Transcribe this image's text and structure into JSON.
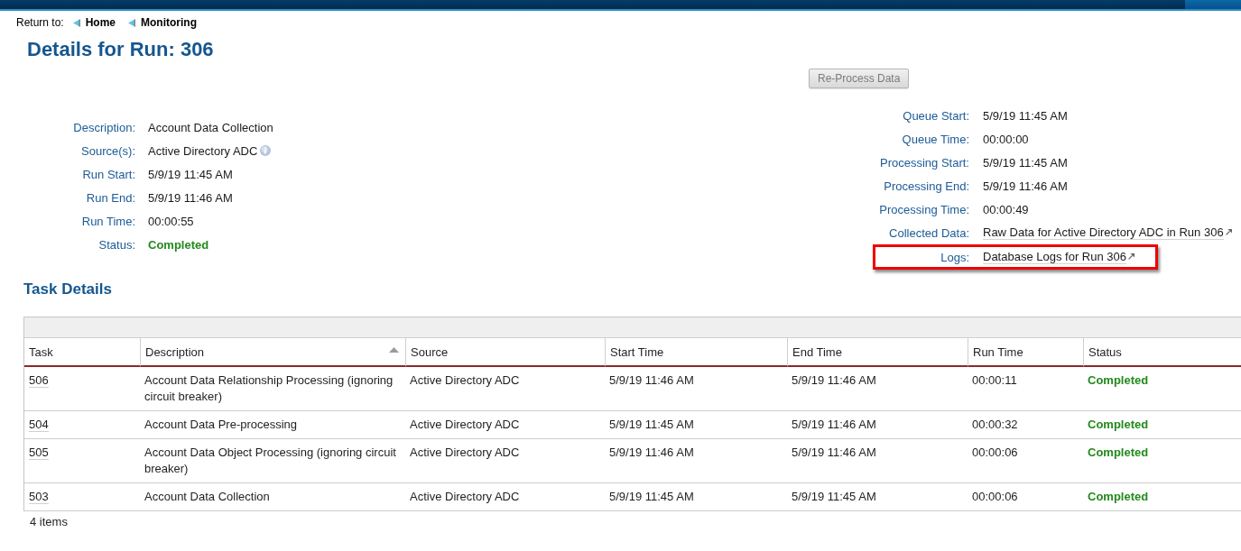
{
  "breadcrumb": {
    "label": "Return to:",
    "links": [
      {
        "text": "Home"
      },
      {
        "text": "Monitoring"
      }
    ]
  },
  "title": "Details for Run: 306",
  "actions": [
    {
      "label": "Re-Process Data",
      "disabled": true
    }
  ],
  "run_details": [
    {
      "label": "Description:",
      "value": "Account Data Collection",
      "kind": "text"
    },
    {
      "label": "Source(s):",
      "value": "Active Directory ADC",
      "kind": "info"
    },
    {
      "label": "Run Start:",
      "value": "5/9/19 11:45 AM",
      "kind": "text"
    },
    {
      "label": "Run End:",
      "value": "5/9/19 11:46 AM",
      "kind": "text"
    },
    {
      "label": "Run Time:",
      "value": "00:00:55",
      "kind": "text"
    },
    {
      "label": "Status:",
      "value": "Completed",
      "kind": "status"
    }
  ],
  "processing_details": [
    {
      "label": "Queue Start:",
      "value": "5/9/19 11:45 AM",
      "kind": "text",
      "highlighted": false
    },
    {
      "label": "Queue Time:",
      "value": "00:00:00",
      "kind": "text",
      "highlighted": false
    },
    {
      "label": "Processing Start:",
      "value": "5/9/19 11:45 AM",
      "kind": "text",
      "highlighted": false
    },
    {
      "label": "Processing End:",
      "value": "5/9/19 11:46 AM",
      "kind": "text",
      "highlighted": false
    },
    {
      "label": "Processing Time:",
      "value": "00:00:49",
      "kind": "text",
      "highlighted": false
    },
    {
      "label": "Collected Data:",
      "value": "Raw Data for Active Directory ADC in Run 306",
      "kind": "link",
      "highlighted": false
    },
    {
      "label": "Logs:",
      "value": "Database Logs for Run 306",
      "kind": "link",
      "highlighted": true
    }
  ],
  "task_details": {
    "title": "Task Details",
    "columns": [
      {
        "label": "Task",
        "kind": "link",
        "sorted": false
      },
      {
        "label": "Description",
        "kind": "text",
        "sorted": true
      },
      {
        "label": "Source",
        "kind": "text",
        "sorted": false
      },
      {
        "label": "Start Time",
        "kind": "text",
        "sorted": false
      },
      {
        "label": "End Time",
        "kind": "text",
        "sorted": false
      },
      {
        "label": "Run Time",
        "kind": "text",
        "sorted": false
      },
      {
        "label": "Status",
        "kind": "status",
        "sorted": false
      }
    ],
    "rows": [
      {
        "cells": [
          "506",
          "Account Data Relationship Processing (ignoring circuit breaker)",
          "Active Directory ADC",
          "5/9/19 11:46 AM",
          "5/9/19 11:46 AM",
          "00:00:11",
          "Completed"
        ]
      },
      {
        "cells": [
          "504",
          "Account Data Pre-processing",
          "Active Directory ADC",
          "5/9/19 11:45 AM",
          "5/9/19 11:46 AM",
          "00:00:32",
          "Completed"
        ]
      },
      {
        "cells": [
          "505",
          "Account Data Object Processing (ignoring circuit breaker)",
          "Active Directory ADC",
          "5/9/19 11:46 AM",
          "5/9/19 11:46 AM",
          "00:00:06",
          "Completed"
        ]
      },
      {
        "cells": [
          "503",
          "Account Data Collection",
          "Active Directory ADC",
          "5/9/19 11:45 AM",
          "5/9/19 11:45 AM",
          "00:00:06",
          "Completed"
        ]
      }
    ],
    "footer": "4 items"
  }
}
